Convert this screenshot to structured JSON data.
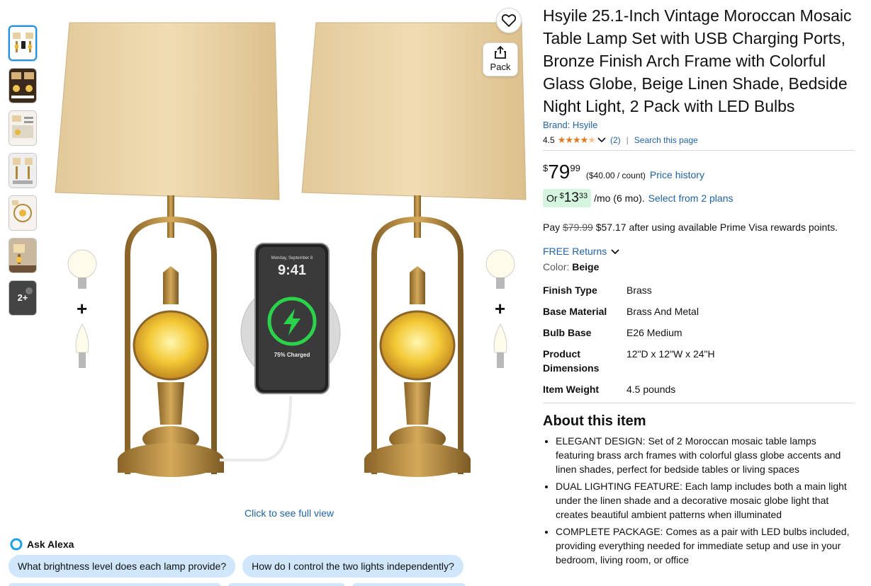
{
  "product": {
    "title": "Hsyile 25.1-Inch Vintage Moroccan Mosaic Table Lamp Set with USB Charging Ports, Bronze Finish Arch Frame with Colorful Glass Globe, Beige Linen Shade, Bedside Night Light, 2 Pack with LED Bulbs",
    "brand": "Brand: Hsyile",
    "rating": "4.5",
    "rating_count": "(2)",
    "search_page": "Search this page"
  },
  "price": {
    "currency": "$",
    "whole": "79",
    "fraction": "99",
    "per_count": "($40.00 / count)",
    "history_link": "Price history"
  },
  "monthly": {
    "prefix": "Or",
    "currency": "$",
    "whole": "13",
    "fraction": "33",
    "suffix": "/mo (6 mo).",
    "plans_link": "Select from 2 plans"
  },
  "prime": {
    "pay": "Pay",
    "old_price": "$79.99",
    "text": "$57.17 after using available Prime Visa rewards points."
  },
  "returns": "FREE Returns",
  "color": {
    "label": "Color:",
    "value": "Beige"
  },
  "specs": [
    {
      "key": "Finish Type",
      "value": "Brass"
    },
    {
      "key": "Base Material",
      "value": "Brass And Metal"
    },
    {
      "key": "Bulb Base",
      "value": "E26 Medium"
    },
    {
      "key": "Product Dimensions",
      "value": "12\"D x 12\"W x 24\"H"
    },
    {
      "key": "Item Weight",
      "value": "4.5 pounds"
    }
  ],
  "about": {
    "heading": "About this item",
    "bullets": [
      "ELEGANT DESIGN: Set of 2 Moroccan mosaic table lamps featuring brass arch frames with colorful glass globe accents and linen shades, perfect for bedside tables or living spaces",
      "DUAL LIGHTING FEATURE: Each lamp includes both a main light under the linen shade and a decorative mosaic globe light that creates beautiful ambient patterns when illuminated",
      "COMPLETE PACKAGE: Comes as a pair with LED bulbs included, providing everything needed for immediate setup and use in your bedroom, living room, or office"
    ]
  },
  "gallery": {
    "share_label": "Pack",
    "full_view": "Click to see full view",
    "more_count": "2+",
    "phone_time": "9:41",
    "phone_date": "Monday, September 8",
    "phone_status": "75% Charged"
  },
  "alexa": {
    "title": "Ask Alexa",
    "questions": [
      "What brightness level does each lamp provide?",
      "How do I control the two lights independently?"
    ]
  },
  "colors": {
    "link": "#2162a1",
    "star": "#de7921",
    "chip": "#cfe6fb",
    "monthly_badge": "#d6f5e0"
  }
}
